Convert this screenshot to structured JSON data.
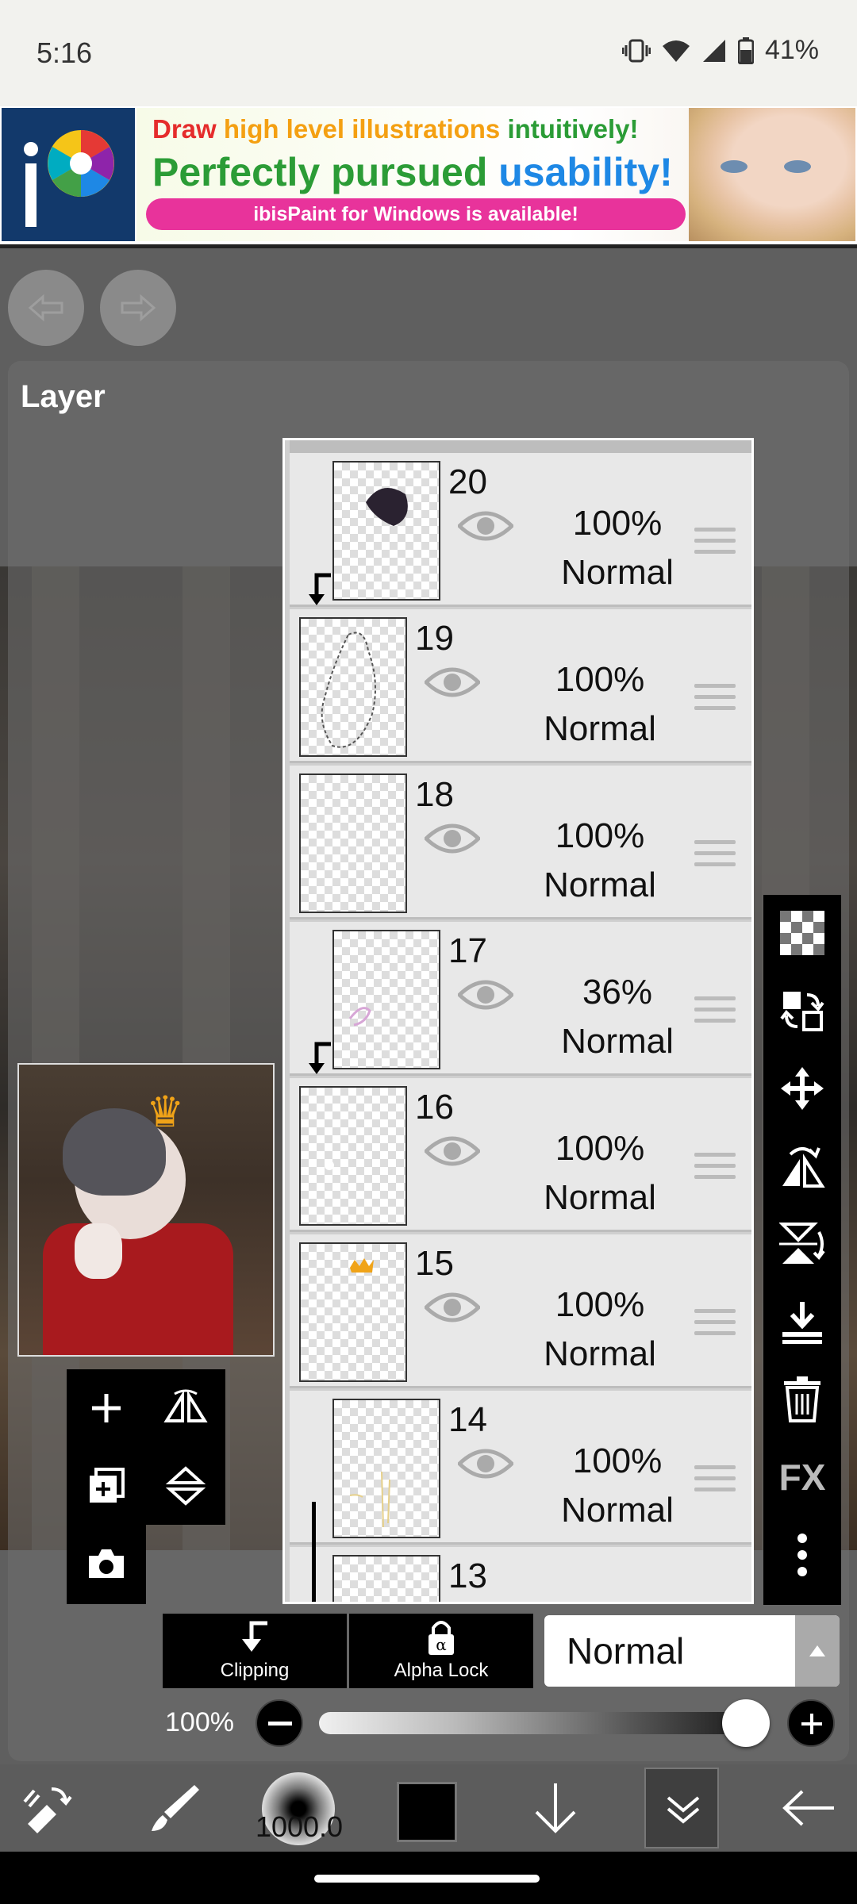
{
  "status_bar": {
    "time": "5:16",
    "battery": "41%"
  },
  "ad": {
    "line1_a": "Draw ",
    "line1_b": "high level illustrations ",
    "line1_c": "intuitively!",
    "line2_a": "Perfectly pursued ",
    "line2_b": "usability!",
    "pill": "ibisPaint for Windows is available!",
    "logo_text": "iP"
  },
  "panel": {
    "title": "Layer"
  },
  "layers": [
    {
      "number": "20",
      "opacity": "100%",
      "mode": "Normal"
    },
    {
      "number": "19",
      "opacity": "100%",
      "mode": "Normal"
    },
    {
      "number": "18",
      "opacity": "100%",
      "mode": "Normal"
    },
    {
      "number": "17",
      "opacity": "36%",
      "mode": "Normal"
    },
    {
      "number": "16",
      "opacity": "100%",
      "mode": "Normal"
    },
    {
      "number": "15",
      "opacity": "100%",
      "mode": "Normal"
    },
    {
      "number": "14",
      "opacity": "100%",
      "mode": "Normal"
    },
    {
      "number": "13",
      "opacity": "",
      "mode": ""
    }
  ],
  "right_toolbar": {
    "fx_label": "FX"
  },
  "controls": {
    "clipping_label": "Clipping",
    "alpha_lock_label": "Alpha Lock",
    "blend_mode": "Normal",
    "opacity_label": "100%",
    "opacity_value": 0.95
  },
  "bottom_toolbar": {
    "brush_size": "1000.0",
    "color": "#000000"
  },
  "colors": {
    "panel_bg": "#6e6e6e",
    "layer_bg": "#e8e8e8",
    "accent_pink": "#e8339b"
  }
}
